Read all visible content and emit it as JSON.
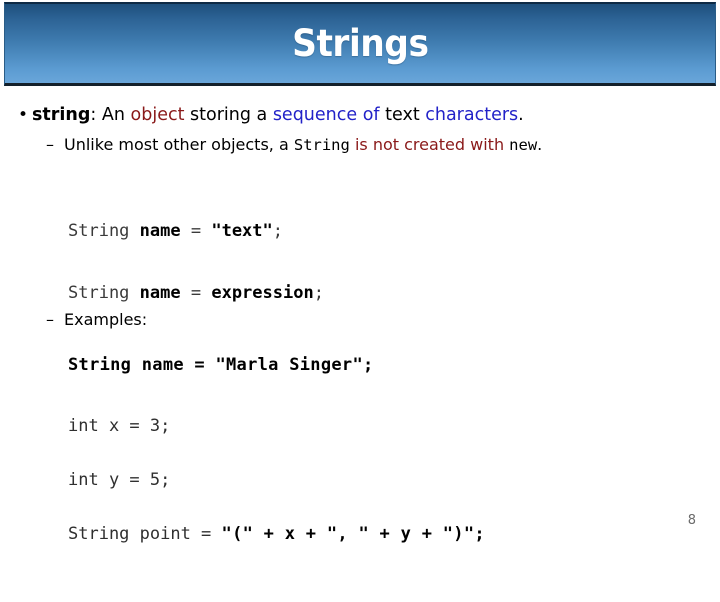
{
  "slide": {
    "title": "Strings",
    "page_number": "8",
    "accent_color": "#3f7cb0",
    "title_band_top_color": "#1d4f7c",
    "title_band_bottom_color": "#6aa6da",
    "keyword_red": "#8a1919",
    "keyword_blue": "#2222c8"
  },
  "bullets": {
    "level1": {
      "marker": "•",
      "term": "string",
      "colon": ": ",
      "seg_an": "An ",
      "seg_object": "object",
      "seg_storing": " storing a ",
      "seg_sequence": "sequence of",
      "seg_text": " text ",
      "seg_characters": "characters",
      "seg_period": "."
    },
    "level2": {
      "marker": "–",
      "seg_unlike": "Unlike most other objects, a ",
      "seg_string_mono": "String",
      "seg_isnot": " is not created with ",
      "seg_new_mono": "new",
      "seg_period": "."
    },
    "examples_label": {
      "marker": "–",
      "text": "Examples:"
    }
  },
  "code": {
    "syntax": {
      "line1": {
        "type": "String",
        "space1": " ",
        "name": "name",
        "eq": " = ",
        "value": "\"text\"",
        "semi": ";"
      },
      "line2": {
        "type": "String",
        "space1": " ",
        "name": "name",
        "eq": " = ",
        "value": "expression",
        "semi": ";"
      }
    },
    "example1": "String name = \"Marla Singer\";",
    "example2": {
      "line1": "int x = 3;",
      "line2": "int y = 5;",
      "line3_head": "String point = ",
      "line3_tail": "\"(\" + x + \", \" + y + \")\";"
    }
  }
}
